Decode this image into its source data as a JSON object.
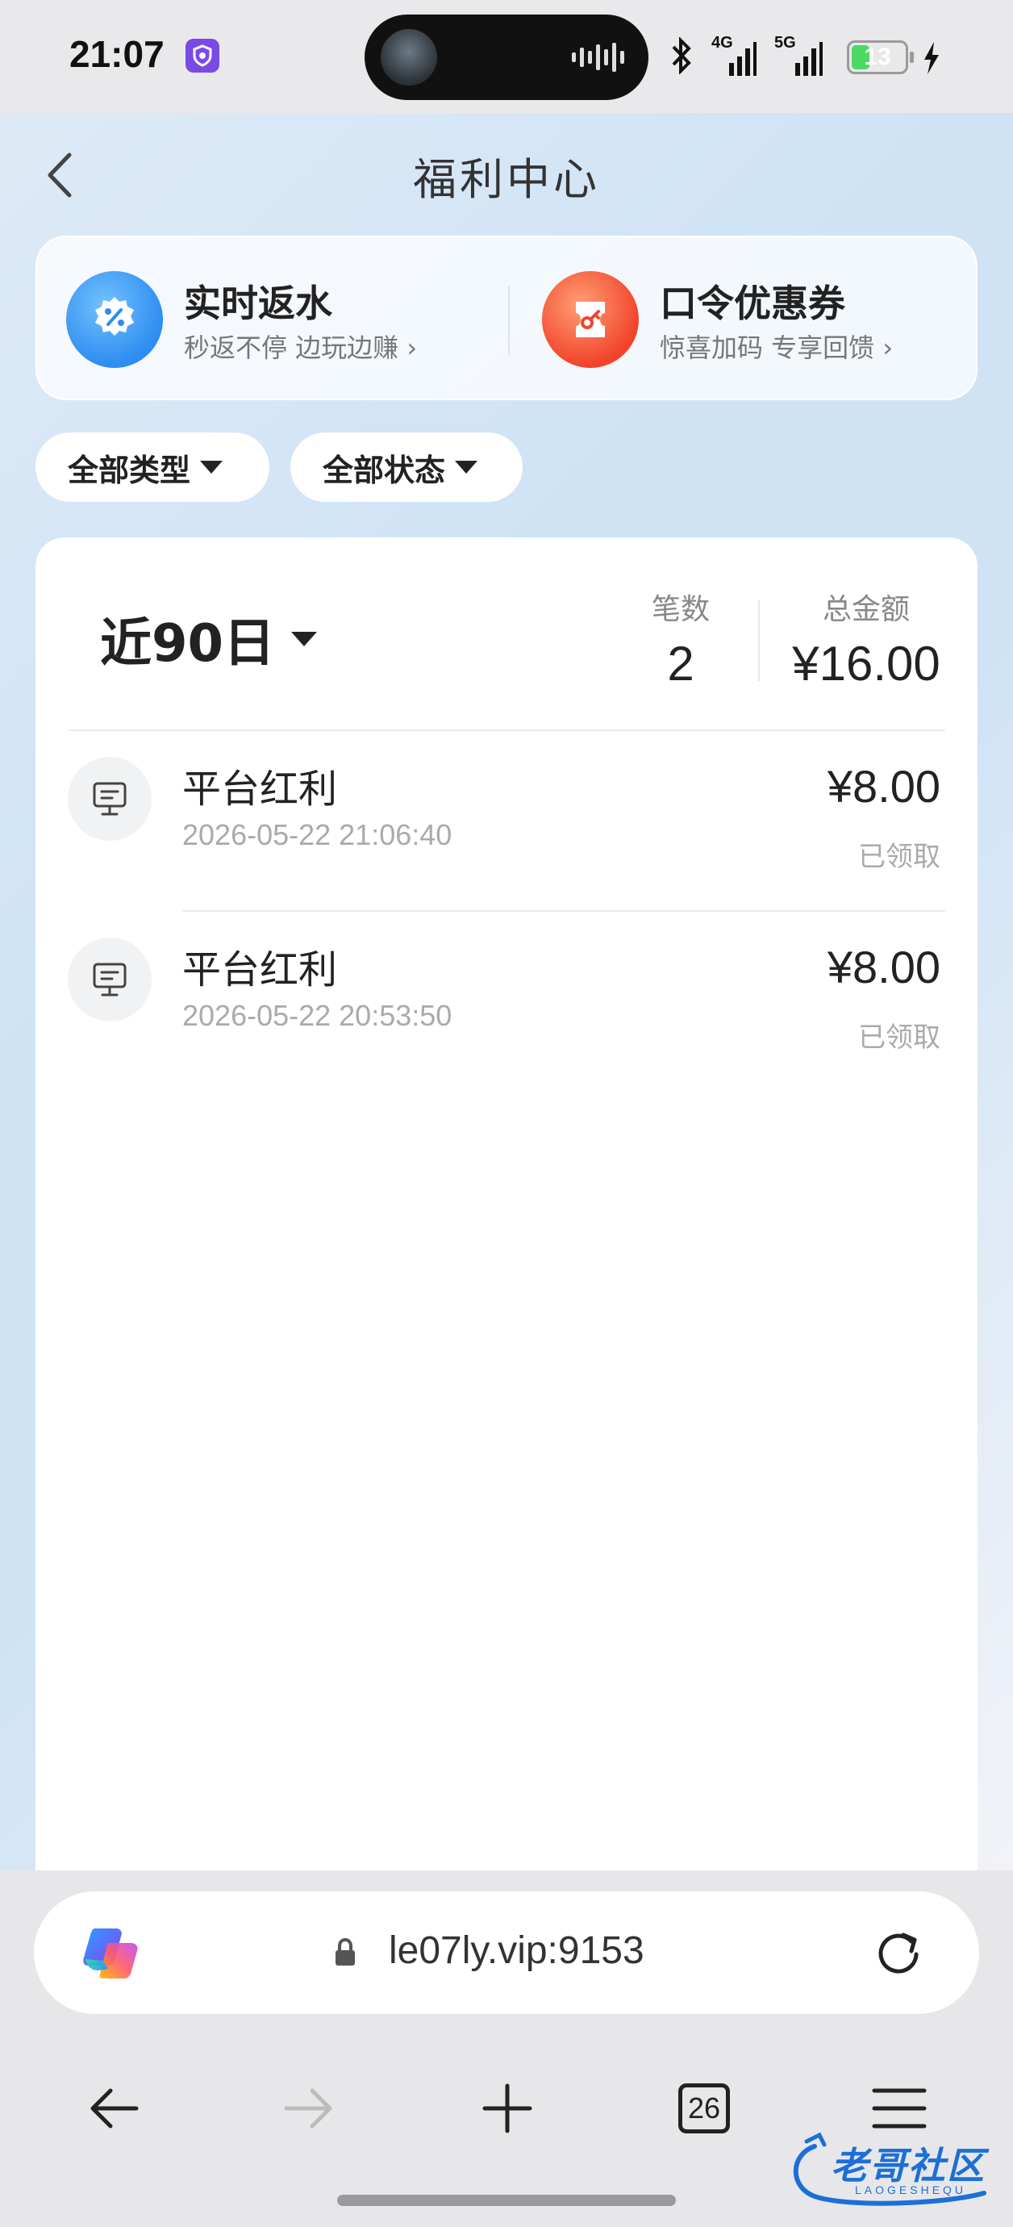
{
  "status_bar": {
    "time": "21:07",
    "network_labels": [
      "4G",
      "5G"
    ],
    "battery_level": "13",
    "battery_fraction": 0.13,
    "icons": [
      "shield-app-icon",
      "voice-wave-icon",
      "bluetooth-icon",
      "signal-icon",
      "battery-icon",
      "charging-bolt-icon"
    ]
  },
  "header": {
    "title": "福利中心"
  },
  "promos": [
    {
      "title": "实时返水",
      "subtitle": "秒返不停 边玩边赚 ›",
      "icon": "percent-badge-icon",
      "color": "#2e8df0"
    },
    {
      "title": "口令优惠券",
      "subtitle": "惊喜加码 专享回馈 ›",
      "icon": "coupon-key-icon",
      "color": "#f2442c"
    }
  ],
  "filters": {
    "type": "全部类型",
    "status": "全部状态"
  },
  "summary": {
    "range": "近90日",
    "count_label": "笔数",
    "count_value": "2",
    "total_label": "总金额",
    "total_value": "¥16.00"
  },
  "records": [
    {
      "title": "平台红利",
      "time": "2026-05-22 21:06:40",
      "amount": "¥8.00",
      "status": "已领取"
    },
    {
      "title": "平台红利",
      "time": "2026-05-22 20:53:50",
      "amount": "¥8.00",
      "status": "已领取"
    }
  ],
  "browser": {
    "url": "le07ly.vip:9153",
    "tabs_count": "26"
  },
  "watermark": {
    "text": "老哥社区",
    "sub": "LAOGESHEQU"
  }
}
